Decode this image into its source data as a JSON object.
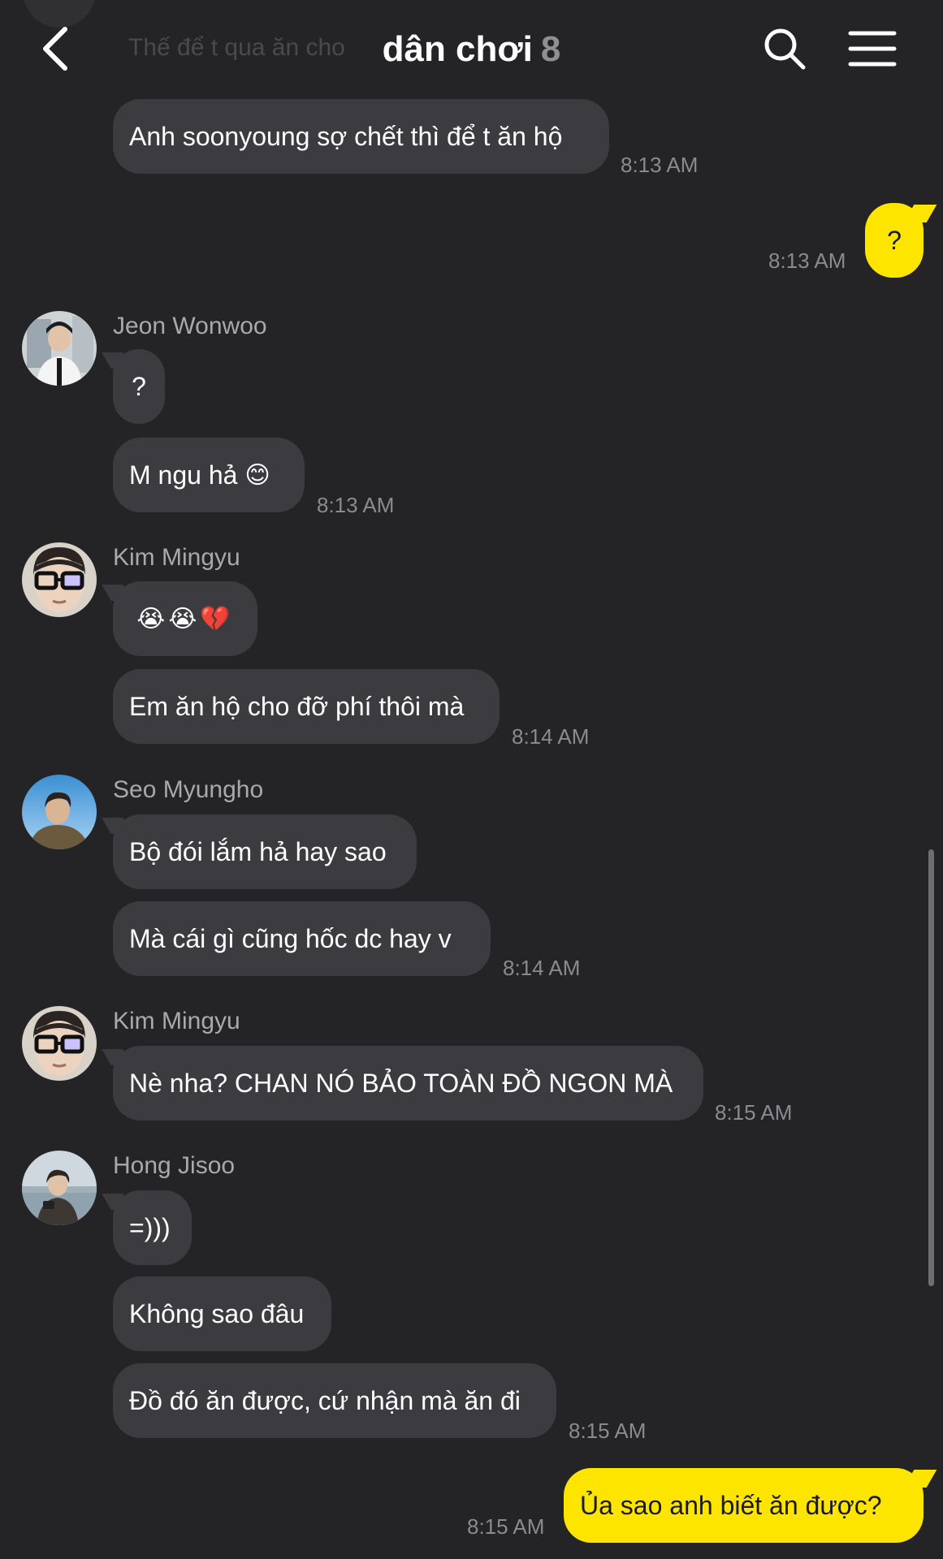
{
  "header": {
    "faded_message": "Thế để t qua ăn cho",
    "title": "dân chơi",
    "member_count": "8",
    "back_icon": "chevron-left-icon",
    "search_icon": "search-icon",
    "menu_icon": "hamburger-menu-icon"
  },
  "colors": {
    "background": "#242427",
    "incoming_bubble": "#3c3c40",
    "outgoing_bubble": "#fee500",
    "timestamp": "#8a8a8f",
    "sender_name": "#a8a8ad"
  },
  "messages": {
    "m1": {
      "text": "Anh soonyoung sợ chết thì để t ăn hộ",
      "time": "8:13 AM"
    },
    "m2": {
      "text": "?",
      "time": "8:13 AM"
    },
    "jeon": {
      "sender": "Jeon Wonwoo",
      "m1": "?",
      "m2": "M ngu hả ",
      "m2_emoji": "😊",
      "time": "8:13 AM"
    },
    "kim1": {
      "sender": "Kim Mingyu",
      "emojis": "😭😭💔",
      "m2": "Em ăn hộ cho đỡ phí thôi mà",
      "time": "8:14 AM"
    },
    "seo": {
      "sender": "Seo Myungho",
      "m1": "Bộ đói lắm hả hay sao",
      "m2": "Mà cái gì cũng hốc dc hay v",
      "time": "8:14 AM"
    },
    "kim2": {
      "sender": "Kim Mingyu",
      "m1": "Nè nha? CHAN NÓ BẢO TOÀN ĐỒ NGON MÀ",
      "time": "8:15 AM"
    },
    "hong": {
      "sender": "Hong Jisoo",
      "m1": "=)))",
      "m2": "Không sao đâu",
      "m3": "Đồ đó ăn được, cứ nhận mà ăn đi",
      "time": "8:15 AM"
    },
    "me_last": {
      "text": "Ủa sao anh biết ăn được?",
      "time": "8:15 AM"
    }
  }
}
